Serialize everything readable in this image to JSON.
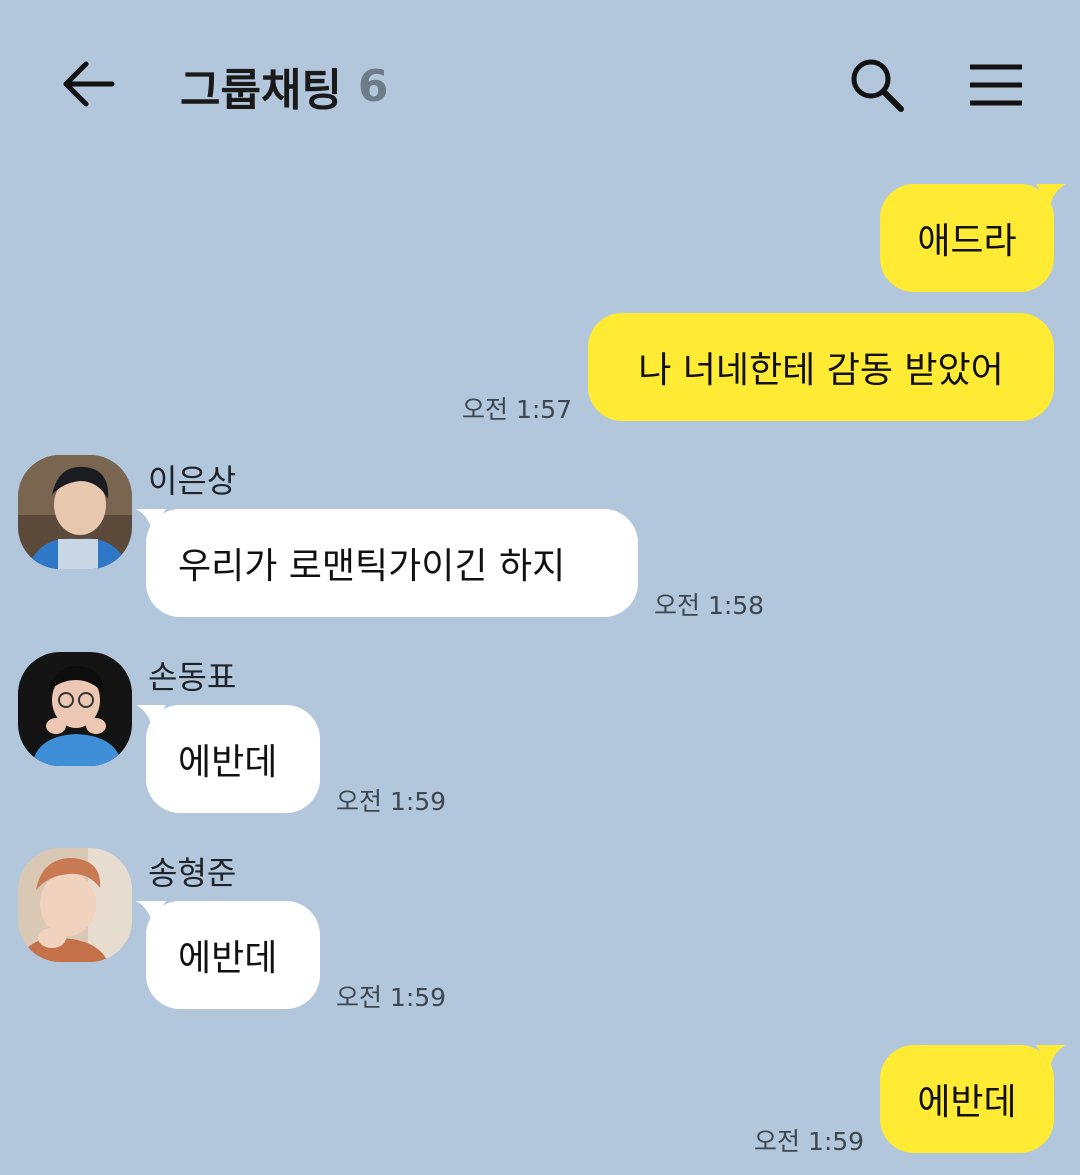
{
  "header": {
    "title": "그룹채팅",
    "member_count": "6"
  },
  "messages": [
    {
      "side": "me",
      "text": "애드라",
      "time": ""
    },
    {
      "side": "me",
      "text": "나 너네한테 감동 받았어",
      "time": "오전 1:57"
    },
    {
      "side": "them",
      "sender": "이은상",
      "text": "우리가 로맨틱가이긴 하지",
      "time": "오전 1:58"
    },
    {
      "side": "them",
      "sender": "손동표",
      "text": "에반데",
      "time": "오전 1:59"
    },
    {
      "side": "them",
      "sender": "송형준",
      "text": "에반데",
      "time": "오전 1:59"
    },
    {
      "side": "me",
      "text": "에반데",
      "time": "오전 1:59"
    }
  ],
  "colors": {
    "background": "#b2c7dc",
    "my_bubble": "#ffeb33",
    "their_bubble": "#ffffff"
  },
  "icons": {
    "back": "arrow-left-icon",
    "search": "search-icon",
    "menu": "hamburger-menu-icon"
  }
}
